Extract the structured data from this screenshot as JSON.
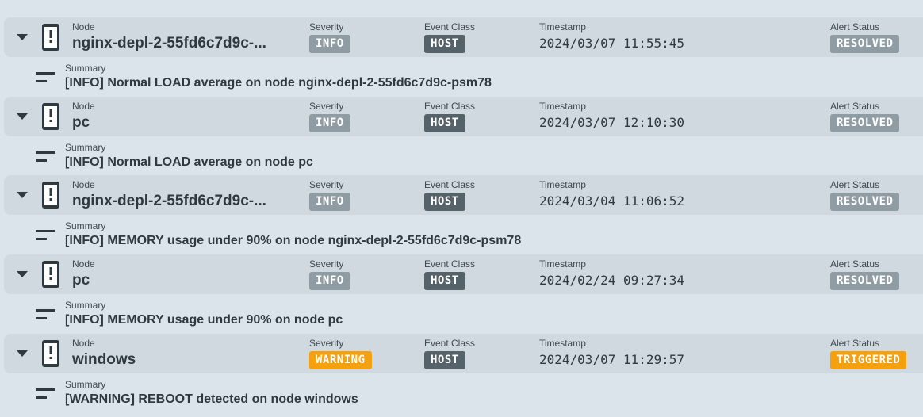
{
  "labels": {
    "node": "Node",
    "severity": "Severity",
    "event_class": "Event Class",
    "timestamp": "Timestamp",
    "alert_status": "Alert Status",
    "summary": "Summary"
  },
  "colors": {
    "info": "#8f9ca4",
    "warning": "#f5a00f",
    "host": "#56626a",
    "resolved": "#8f9ca4",
    "triggered": "#f5a00f"
  },
  "icons": {
    "expand": "caret-down-icon",
    "device": "mobile-alert-icon",
    "summary": "summary-lines-icon"
  },
  "alerts": [
    {
      "node": "nginx-depl-2-55fd6c7d9c-...",
      "severity": "INFO",
      "event_class": "HOST",
      "timestamp": "2024/03/07 11:55:45",
      "status": "RESOLVED",
      "summary": "[INFO] Normal LOAD average on node nginx-depl-2-55fd6c7d9c-psm78"
    },
    {
      "node": "pc",
      "severity": "INFO",
      "event_class": "HOST",
      "timestamp": "2024/03/07 12:10:30",
      "status": "RESOLVED",
      "summary": "[INFO] Normal LOAD average on node pc"
    },
    {
      "node": "nginx-depl-2-55fd6c7d9c-...",
      "severity": "INFO",
      "event_class": "HOST",
      "timestamp": "2024/03/04 11:06:52",
      "status": "RESOLVED",
      "summary": "[INFO] MEMORY usage under 90% on node nginx-depl-2-55fd6c7d9c-psm78"
    },
    {
      "node": "pc",
      "severity": "INFO",
      "event_class": "HOST",
      "timestamp": "2024/02/24 09:27:34",
      "status": "RESOLVED",
      "summary": "[INFO] MEMORY usage under 90% on node pc"
    },
    {
      "node": "windows",
      "severity": "WARNING",
      "event_class": "HOST",
      "timestamp": "2024/03/07 11:29:57",
      "status": "TRIGGERED",
      "summary": "[WARNING] REBOOT detected on node windows"
    }
  ]
}
